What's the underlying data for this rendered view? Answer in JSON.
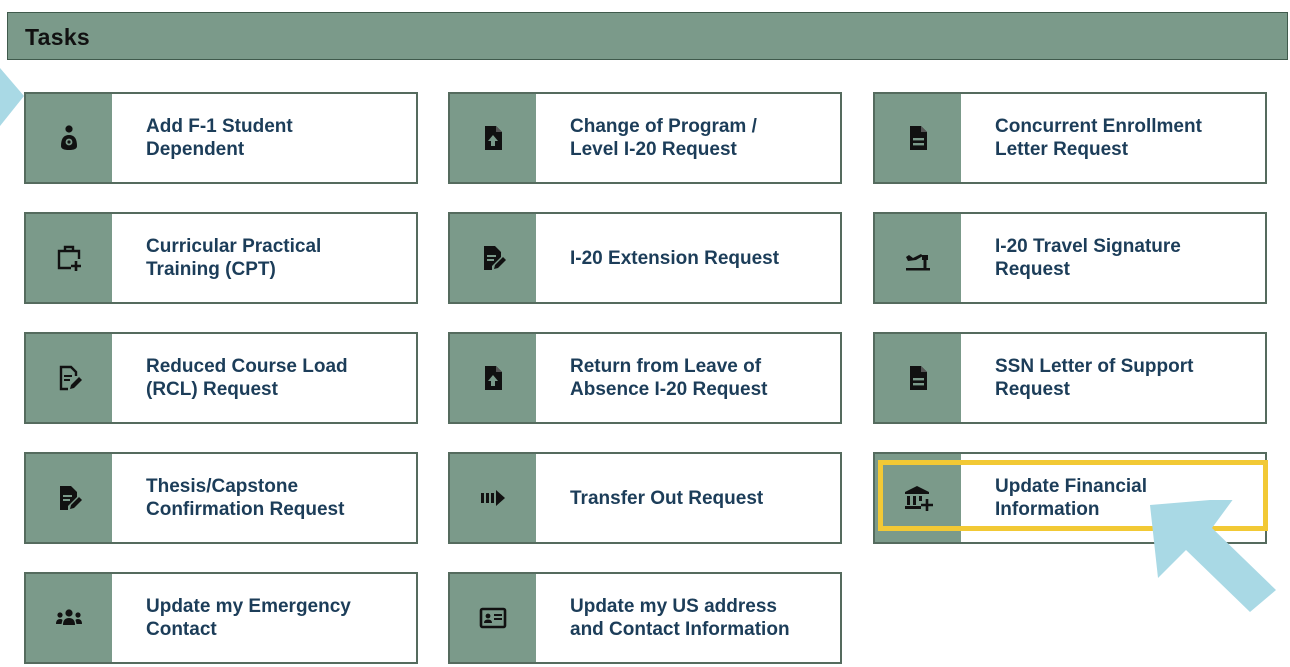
{
  "header": {
    "title": "Tasks"
  },
  "colors": {
    "header_bg": "#7b9a8a",
    "card_border": "#556b5e",
    "label_text": "#1c3d59",
    "highlight": "#f2c935",
    "annotation_arrow": "#a9d9e5"
  },
  "tasks": [
    {
      "label": "Add F-1 Student\nDependent",
      "icon": "person-baby-icon"
    },
    {
      "label": "Change of Program /\nLevel I-20 Request",
      "icon": "file-upload-icon"
    },
    {
      "label": "Concurrent Enrollment\nLetter Request",
      "icon": "file-lines-icon"
    },
    {
      "label": "Curricular Practical\nTraining (CPT)",
      "icon": "briefcase-plus-icon"
    },
    {
      "label": "I-20 Extension Request",
      "icon": "file-edit-icon"
    },
    {
      "label": "I-20 Travel Signature\nRequest",
      "icon": "plane-departure-icon"
    },
    {
      "label": "Reduced Course Load\n(RCL) Request",
      "icon": "file-edit-outline-icon"
    },
    {
      "label": "Return from Leave of\nAbsence I-20 Request",
      "icon": "file-upload-icon"
    },
    {
      "label": "SSN Letter of Support\nRequest",
      "icon": "file-lines-icon"
    },
    {
      "label": "Thesis/Capstone\nConfirmation Request",
      "icon": "file-edit-icon"
    },
    {
      "label": "Transfer Out Request",
      "icon": "arrow-transfer-icon"
    },
    {
      "label": "Update Financial\nInformation",
      "icon": "bank-plus-icon"
    },
    {
      "label": "Update my Emergency\nContact",
      "icon": "people-group-icon"
    },
    {
      "label": "Update my US address\nand Contact Information",
      "icon": "id-card-icon"
    }
  ]
}
